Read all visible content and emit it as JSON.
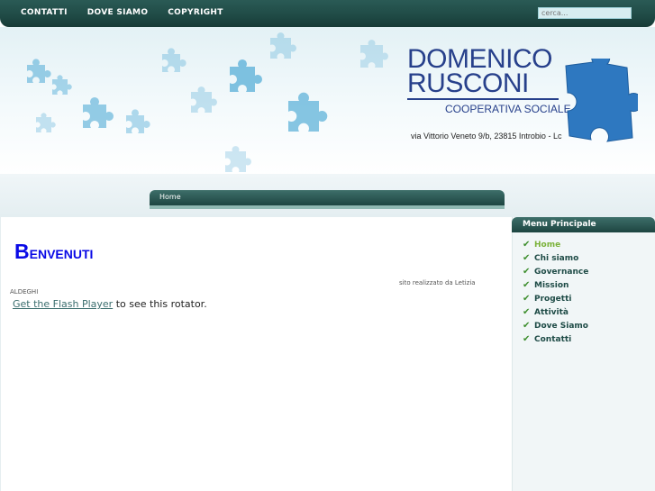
{
  "topnav": {
    "items": [
      "CONTATTI",
      "DOVE SIAMO",
      "COPYRIGHT"
    ],
    "search_placeholder": "cerca..."
  },
  "header": {
    "logo_line1": "DOMENICO",
    "logo_line2": "RUSCONI",
    "logo_line3": "COOPERATIVA SOCIALE",
    "address": "via Vittorio Veneto 9/b, 23815 Introbio - Lc"
  },
  "breadcrumb": {
    "label": "Home"
  },
  "main": {
    "title_first": "B",
    "title_rest": "ENVENUTI",
    "credit": "sito  realizzato da Letizia",
    "credit2": "ALDEGHI",
    "flash_link": "Get the Flash Player",
    "flash_text": " to see this rotator."
  },
  "sidebar": {
    "heading": "Menu Principale",
    "items": [
      "Home",
      "Chi siamo",
      "Governance",
      "Mission",
      "Progetti",
      "Attività",
      "Dove Siamo",
      "Contatti"
    ]
  },
  "colors": {
    "accent": "#1d4541",
    "title": "#0a0ae6",
    "logo": "#27408b",
    "puzzle": "#5bb0d8",
    "active": "#7bb23a"
  },
  "icons": {
    "puzzle": "puzzle-piece-icon",
    "check": "check-icon"
  }
}
